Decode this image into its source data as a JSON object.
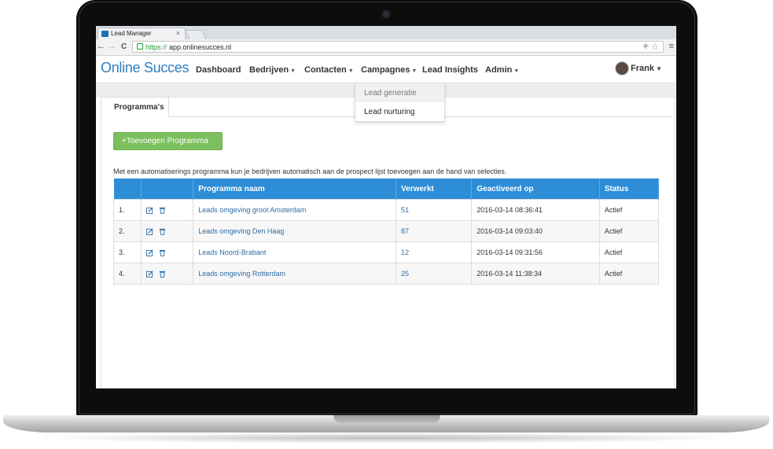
{
  "browser": {
    "tab_title": "Lead Manager",
    "tab_close": "×",
    "url_scheme": "https://",
    "url_host": "app.onlinesucces.nl",
    "back_glyph": "←",
    "forward_glyph": "→",
    "reload_glyph": "C"
  },
  "app": {
    "logo": "Online Succes",
    "nav": [
      {
        "label": "Dashboard"
      },
      {
        "label": "Bedrijven"
      },
      {
        "label": "Contacten"
      },
      {
        "label": "Campagnes"
      },
      {
        "label": "Lead Insights"
      },
      {
        "label": "Admin"
      }
    ],
    "user": "Frank",
    "dropdown": [
      "Lead generatie",
      "Lead nurturing"
    ]
  },
  "page": {
    "tab_label": "Programma's",
    "add_button": "+Toevoegen Programma",
    "description": "Met een automatiserings programma kun je bedrijven automatisch aan de prospect lijst toevoegen aan de hand van selecties.",
    "table": {
      "headers": [
        "",
        "",
        "Programma naam",
        "Verwerkt",
        "Geactiveerd op",
        "Status"
      ],
      "rows": [
        {
          "num": "1.",
          "name": "Leads omgeving groot Amsterdam",
          "processed": "51",
          "activated": "2016-03-14 08:36:41",
          "status": "Actief"
        },
        {
          "num": "2.",
          "name": "Leads omgeving Den Haag",
          "processed": "87",
          "activated": "2016-03-14 09:03:40",
          "status": "Actief"
        },
        {
          "num": "3.",
          "name": "Leads Noord-Brabant",
          "processed": "12",
          "activated": "2016-03-14 09:31:56",
          "status": "Actief"
        },
        {
          "num": "4.",
          "name": "Leads omgeving Rotterdam",
          "processed": "25",
          "activated": "2016-03-14 11:38:34",
          "status": "Actief"
        }
      ]
    }
  },
  "colors": {
    "brand": "#2e7fc2",
    "table_header": "#2d8ed7",
    "add_button": "#7cbf5e",
    "link": "#2e6da4"
  }
}
